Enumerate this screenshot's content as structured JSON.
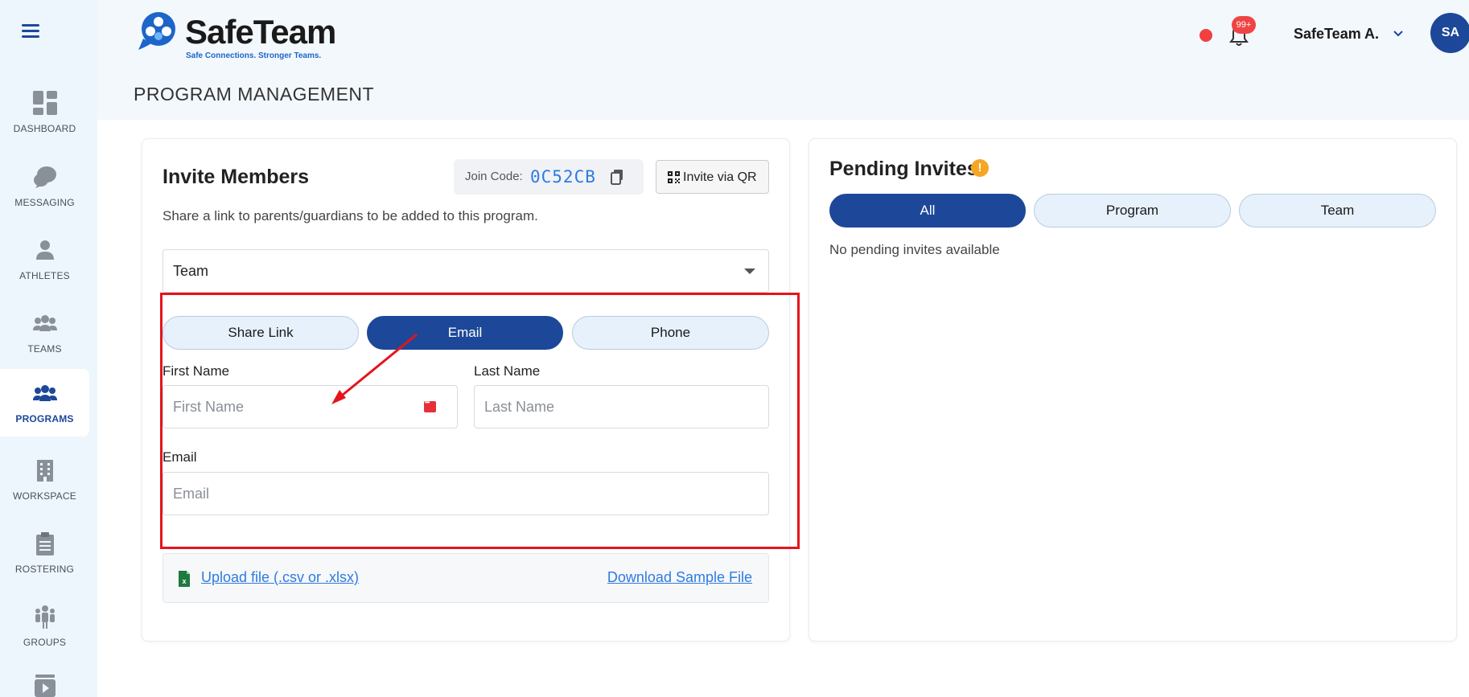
{
  "brand": {
    "name": "SafeTeam",
    "tagline": "Safe Connections. Stronger Teams."
  },
  "page_title": "PROGRAM MANAGEMENT",
  "header": {
    "notification_count": "99+",
    "user_name": "SafeTeam A.",
    "avatar_initials": "SA"
  },
  "sidebar": {
    "items": [
      {
        "label": "DASHBOARD",
        "icon": "dashboard-icon"
      },
      {
        "label": "MESSAGING",
        "icon": "chat-icon"
      },
      {
        "label": "ATHLETES",
        "icon": "person-icon"
      },
      {
        "label": "TEAMS",
        "icon": "users-icon"
      },
      {
        "label": "PROGRAMS",
        "icon": "users-icon",
        "active": true
      },
      {
        "label": "WORKSPACE",
        "icon": "building-icon"
      },
      {
        "label": "ROSTERING",
        "icon": "clipboard-icon"
      },
      {
        "label": "GROUPS",
        "icon": "group-icon"
      },
      {
        "label": "",
        "icon": "video-icon"
      }
    ]
  },
  "invite": {
    "title": "Invite Members",
    "join_code_label": "Join Code:",
    "join_code": "0C52CB",
    "qr_button": "Invite via QR",
    "description": "Share a link to parents/guardians to be added to this program.",
    "select_value": "Team",
    "tabs": [
      {
        "label": "Share Link",
        "active": false
      },
      {
        "label": "Email",
        "active": true
      },
      {
        "label": "Phone",
        "active": false
      }
    ],
    "first_name_label": "First Name",
    "first_name_placeholder": "First Name",
    "last_name_label": "Last Name",
    "last_name_placeholder": "Last Name",
    "email_label": "Email",
    "email_placeholder": "Email",
    "upload_link": "Upload file (.csv or .xlsx)",
    "sample_link": "Download Sample File"
  },
  "pending": {
    "title": "Pending Invites",
    "tabs": [
      {
        "label": "All",
        "active": true
      },
      {
        "label": "Program",
        "active": false
      },
      {
        "label": "Team",
        "active": false
      }
    ],
    "empty_text": "No pending invites available"
  },
  "colors": {
    "primary": "#1d4899",
    "accent_blue": "#2f7be0",
    "highlight_red": "#e5141c",
    "warning": "#f5a623"
  }
}
